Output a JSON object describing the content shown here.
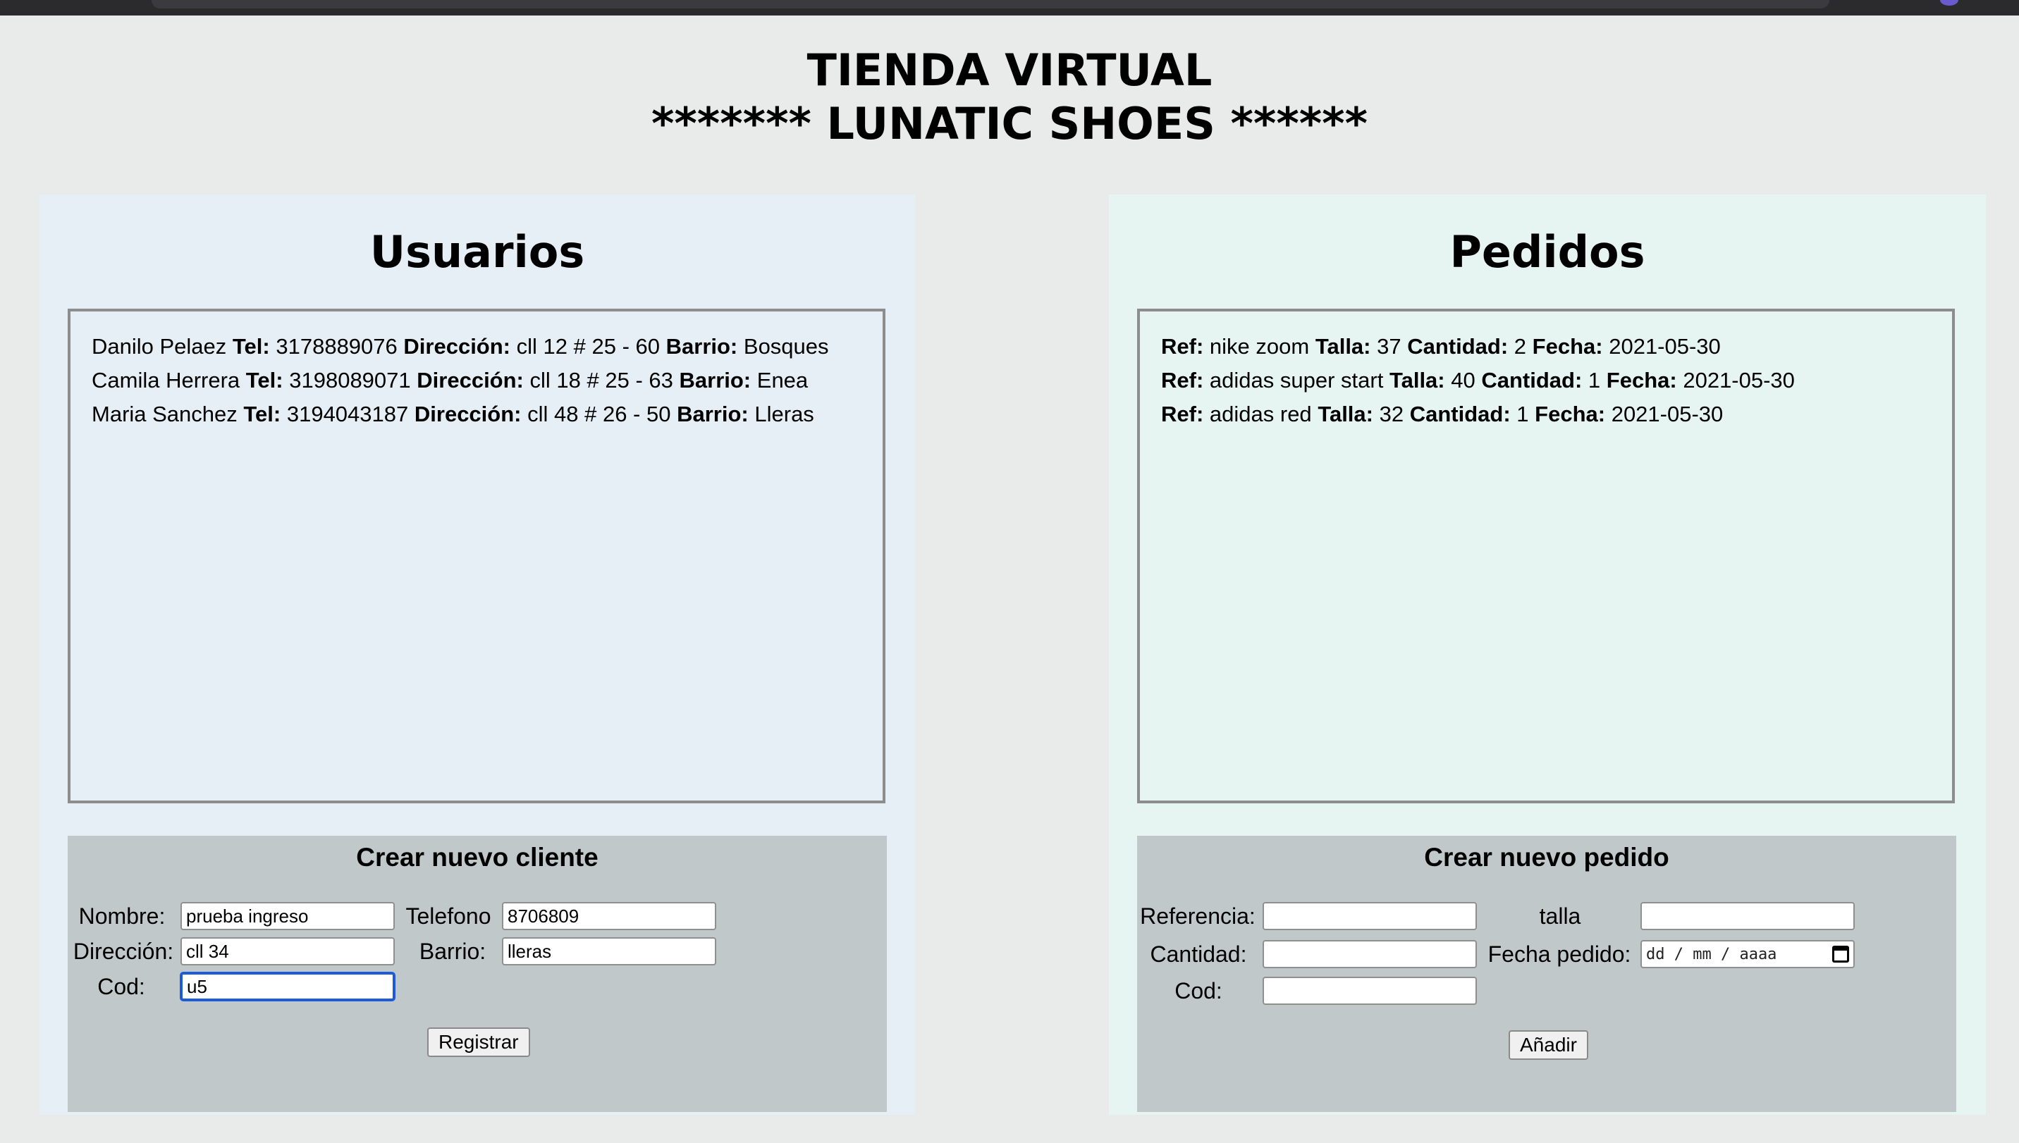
{
  "header": {
    "title_line1": "TIENDA VIRTUAL",
    "title_line2": "******* LUNATIC SHOES ******"
  },
  "users": {
    "heading": "Usuarios",
    "field_labels": {
      "tel": "Tel:",
      "direccion": "Dirección:",
      "barrio": "Barrio:"
    },
    "items": [
      {
        "name": "Danilo Pelaez",
        "tel": "3178889076",
        "direccion": "cll 12 # 25 - 60",
        "barrio": "Bosques"
      },
      {
        "name": "Camila Herrera",
        "tel": "3198089071",
        "direccion": "cll 18 # 25 - 63",
        "barrio": "Enea"
      },
      {
        "name": "Maria Sanchez",
        "tel": "3194043187",
        "direccion": "cll 48 # 26 - 50",
        "barrio": "Lleras"
      }
    ],
    "form": {
      "title": "Crear nuevo cliente",
      "nombre_label": "Nombre:",
      "nombre_value": "prueba ingreso",
      "telefono_label": "Telefono",
      "telefono_value": "8706809",
      "direccion_label": "Dirección:",
      "direccion_value": "cll 34",
      "barrio_label": "Barrio:",
      "barrio_value": "lleras",
      "cod_label": "Cod:",
      "cod_value": "u5",
      "submit_label": "Registrar"
    }
  },
  "orders": {
    "heading": "Pedidos",
    "field_labels": {
      "ref": "Ref:",
      "talla": "Talla:",
      "cantidad": "Cantidad:",
      "fecha": "Fecha:"
    },
    "items": [
      {
        "ref": "nike zoom",
        "talla": "37",
        "cantidad": "2",
        "fecha": "2021-05-30"
      },
      {
        "ref": "adidas super start",
        "talla": "40",
        "cantidad": "1",
        "fecha": "2021-05-30"
      },
      {
        "ref": "adidas red",
        "talla": "32",
        "cantidad": "1",
        "fecha": "2021-05-30"
      }
    ],
    "form": {
      "title": "Crear nuevo pedido",
      "referencia_label": "Referencia:",
      "referencia_value": "",
      "talla_label": "talla",
      "talla_value": "",
      "cantidad_label": "Cantidad:",
      "cantidad_value": "",
      "fecha_label": "Fecha pedido:",
      "fecha_placeholder": "dd / mm / aaaa",
      "cod_label": "Cod:",
      "cod_value": "",
      "submit_label": "Añadir"
    }
  },
  "icons": {
    "date_picker": "calendar-icon"
  },
  "colors": {
    "page_background": "#e9ebea",
    "users_panel": "#e7eff6",
    "orders_panel": "#e7f5f2",
    "form_background": "#c1c8c9",
    "focus_ring": "#1e5bd8"
  }
}
